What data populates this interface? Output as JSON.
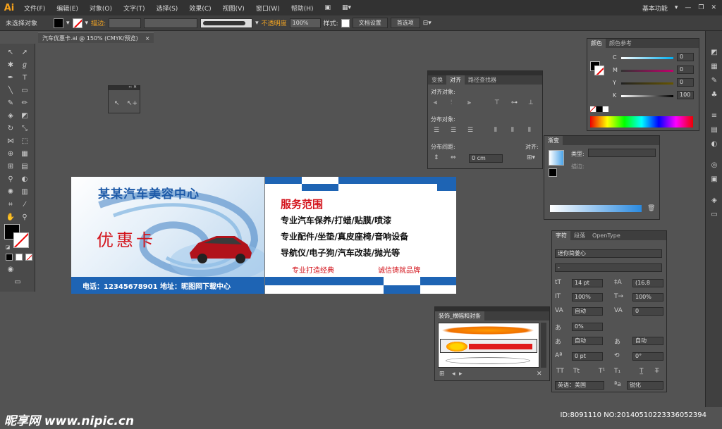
{
  "app": {
    "logo": "Ai"
  },
  "menu": [
    "文件(F)",
    "编辑(E)",
    "对象(O)",
    "文字(T)",
    "选择(S)",
    "效果(C)",
    "视图(V)",
    "窗口(W)",
    "帮助(H)"
  ],
  "workspace": "基本功能",
  "control_bar": {
    "selection": "未选择对象",
    "stroke_label": "描边:",
    "opacity_label": "不透明度",
    "opacity_value": "100%",
    "style_label": "样式:",
    "doc_settings": "文档设置",
    "preferences": "首选项"
  },
  "doc_tab": {
    "title": "汽车优惠卡.ai @ 150% (CMYK/预览)",
    "close": "×"
  },
  "align_panel": {
    "tabs": [
      "变换",
      "对齐",
      "路径查找器"
    ],
    "align_objects": "对齐对象:",
    "distribute_objects": "分布对象:",
    "distribute_spacing": "分布间距:",
    "align_to": "对齐:",
    "spacing_value": "0 cm"
  },
  "color_panel": {
    "tabs": [
      "颜色",
      "颜色参考"
    ],
    "channels": [
      {
        "name": "C",
        "value": "0"
      },
      {
        "name": "M",
        "value": "0"
      },
      {
        "name": "Y",
        "value": "0"
      },
      {
        "name": "K",
        "value": "100"
      }
    ]
  },
  "gradient_panel": {
    "tab": "渐变",
    "type_label": "类型:",
    "stroke_label": "描边:"
  },
  "char_panel": {
    "tabs": [
      "字符",
      "段落",
      "OpenType"
    ],
    "font": "迷你简姜心",
    "style": "-",
    "size": "14 pt",
    "leading": "(16.8",
    "hscale": "100%",
    "vscale": "100%",
    "kerning": "自动",
    "tracking": "0",
    "shift": "0%",
    "auto1": "自动",
    "auto2": "自动",
    "baseline": "0 pt",
    "rotate": "0°",
    "language": "英语：美国",
    "aa": "锐化"
  },
  "brush_panel": {
    "title": "装饰_横幅和封条"
  },
  "card": {
    "title": "某某汽车美容中心",
    "subtitle": "优惠卡",
    "contact": "电话：12345678901  地址：昵图网下载中心",
    "service_title": "服务范围",
    "lines": [
      "专业汽车保养/打蜡/贴膜/喷漆",
      "专业配件/坐垫/真皮座椅/音响设备",
      "导航仪/电子狗/汽车改装/抛光等"
    ],
    "footer_left": "专业打造经典",
    "footer_right": "诚信铸就品牌"
  },
  "watermark": {
    "left": "昵享网 www.nipic.cn",
    "right": "ID:8091110 NO:20140510223336052394"
  }
}
